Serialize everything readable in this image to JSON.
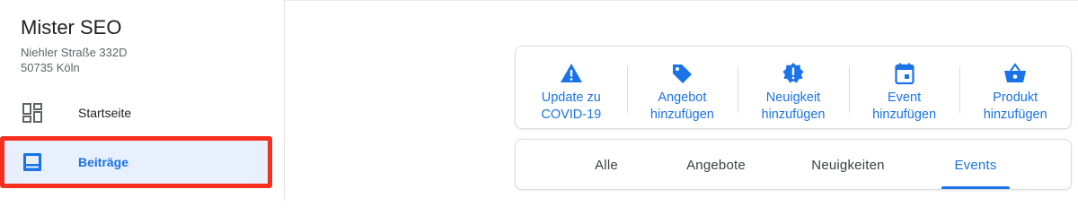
{
  "sidebar": {
    "business_name": "Mister SEO",
    "address_line1": "Niehler Straße 332D",
    "address_line2": "50735 Köln",
    "items": [
      {
        "label": "Startseite",
        "icon": "dashboard-icon"
      },
      {
        "label": "Beiträge",
        "icon": "posts-icon",
        "active": true
      }
    ]
  },
  "actions": [
    {
      "label": "Update zu COVID-19",
      "line1": "Update zu",
      "line2": "COVID-19",
      "icon": "warning-icon"
    },
    {
      "label": "Angebot hinzufügen",
      "line1": "Angebot",
      "line2": "hinzufügen",
      "icon": "tag-icon"
    },
    {
      "label": "Neuigkeit hinzufügen",
      "line1": "Neuigkeit",
      "line2": "hinzufügen",
      "icon": "news-icon"
    },
    {
      "label": "Event hinzufügen",
      "line1": "Event",
      "line2": "hinzufügen",
      "icon": "calendar-icon"
    },
    {
      "label": "Produkt hinzufügen",
      "line1": "Produkt",
      "line2": "hinzufügen",
      "icon": "basket-icon"
    }
  ],
  "tabs": [
    {
      "label": "Alle"
    },
    {
      "label": "Angebote"
    },
    {
      "label": "Neuigkeiten"
    },
    {
      "label": "Events",
      "active": true
    }
  ],
  "colors": {
    "accent": "#1a73e8",
    "highlight_bg": "#e8f0fe",
    "annotation_red": "#f62f1f"
  }
}
